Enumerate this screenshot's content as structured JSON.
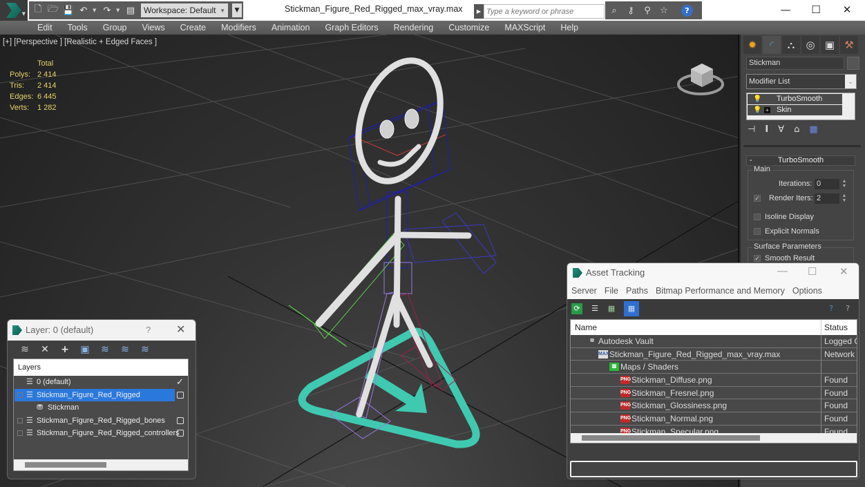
{
  "app": {
    "workspace": "Workspace: Default",
    "document_title": "Stickman_Figure_Red_Rigged_max_vray.max",
    "search_placeholder": "Type a keyword or phrase",
    "window_controls": {
      "minimize": "—",
      "maximize": "☐",
      "close": "✕"
    }
  },
  "quick_access": {
    "icons": [
      "new-file-icon",
      "open-folder-icon",
      "save-icon",
      "undo-icon",
      "redo-icon",
      "project-folder-icon"
    ]
  },
  "info_center": {
    "icons": [
      "binoculars-icon",
      "key-icon",
      "satellite-icon",
      "star-icon",
      "help-icon"
    ]
  },
  "menu": {
    "items": [
      "Edit",
      "Tools",
      "Group",
      "Views",
      "Create",
      "Modifiers",
      "Animation",
      "Graph Editors",
      "Rendering",
      "Customize",
      "MAXScript",
      "Help"
    ]
  },
  "viewport": {
    "label": "[+] [Perspective ] [Realistic + Edged Faces ]",
    "stats": {
      "header": "Total",
      "rows": [
        {
          "label": "Polys:",
          "value": "2 414"
        },
        {
          "label": "Tris:",
          "value": "2 414"
        },
        {
          "label": "Edges:",
          "value": "6 445"
        },
        {
          "label": "Verts:",
          "value": "1 282"
        }
      ]
    },
    "colors": {
      "mesh": "#e8e8e8",
      "control_circle": "#3fc9b0",
      "bone_blue": "#1e1eb4",
      "bone_green": "#5ad04a",
      "bone_purple": "#9a7ae0",
      "bone_red": "#a0204a",
      "stats_text": "#e6d36a"
    }
  },
  "command_panel": {
    "tabs": [
      "create-tab",
      "modify-tab",
      "hierarchy-tab",
      "motion-tab",
      "display-tab",
      "utilities-tab"
    ],
    "object_name": "Stickman",
    "modifier_list": "Modifier List",
    "stack": [
      {
        "label": "TurboSmooth",
        "has_box": false
      },
      {
        "label": "Skin",
        "has_box": true
      }
    ],
    "rollout": {
      "title": "TurboSmooth",
      "collapse": "-",
      "main_group": "Main",
      "iterations_label": "Iterations:",
      "iterations_value": "0",
      "render_iters_label": "Render Iters:",
      "render_iters_value": "2",
      "render_iters_checked": true,
      "isoline_label": "Isoline Display",
      "isoline_checked": false,
      "explicit_normals_label": "Explicit Normals",
      "explicit_normals_checked": false,
      "surface_group": "Surface Parameters",
      "smooth_result_label": "Smooth Result",
      "smooth_result_checked": true
    }
  },
  "layer_dialog": {
    "title": "Layer: 0 (default)",
    "help": "?",
    "close": "✕",
    "column_header": "Layers",
    "rows": [
      {
        "name": "0 (default)",
        "type": "layer",
        "indent": 0,
        "expandable": false,
        "selected": false,
        "current": true
      },
      {
        "name": "Stickman_Figure_Red_Rigged",
        "type": "layer",
        "indent": 0,
        "expandable": true,
        "selected": true,
        "current": false
      },
      {
        "name": "Stickman",
        "type": "object",
        "indent": 1,
        "expandable": false,
        "selected": false,
        "current": false
      },
      {
        "name": "Stickman_Figure_Red_Rigged_bones",
        "type": "layer",
        "indent": 0,
        "expandable": true,
        "selected": false,
        "current": false
      },
      {
        "name": "Stickman_Figure_Red_Rigged_controllers",
        "type": "layer",
        "indent": 0,
        "expandable": true,
        "selected": false,
        "current": false
      }
    ]
  },
  "asset_dialog": {
    "title": "Asset Tracking",
    "menu": [
      "Server",
      "File",
      "Paths",
      "Bitmap Performance and Memory",
      "Options"
    ],
    "columns": {
      "name": "Name",
      "status": "Status"
    },
    "rows": [
      {
        "name": "Autodesk Vault",
        "status": "Logged Out",
        "icon": "vault-icon",
        "level": 0
      },
      {
        "name": "Stickman_Figure_Red_Rigged_max_vray.max",
        "status": "Network Path",
        "icon": "max-file-icon",
        "level": 1
      },
      {
        "name": "Maps / Shaders",
        "status": "",
        "icon": "maps-icon",
        "level": 2
      },
      {
        "name": "Stickman_Diffuse.png",
        "status": "Found",
        "icon": "png-icon",
        "level": 3
      },
      {
        "name": "Stickman_Fresnel.png",
        "status": "Found",
        "icon": "png-icon",
        "level": 3
      },
      {
        "name": "Stickman_Glossiness.png",
        "status": "Found",
        "icon": "png-icon",
        "level": 3
      },
      {
        "name": "Stickman_Normal.png",
        "status": "Found",
        "icon": "png-icon",
        "level": 3
      },
      {
        "name": "Stickman_Specular.png",
        "status": "Found",
        "icon": "png-icon",
        "level": 3
      }
    ]
  }
}
